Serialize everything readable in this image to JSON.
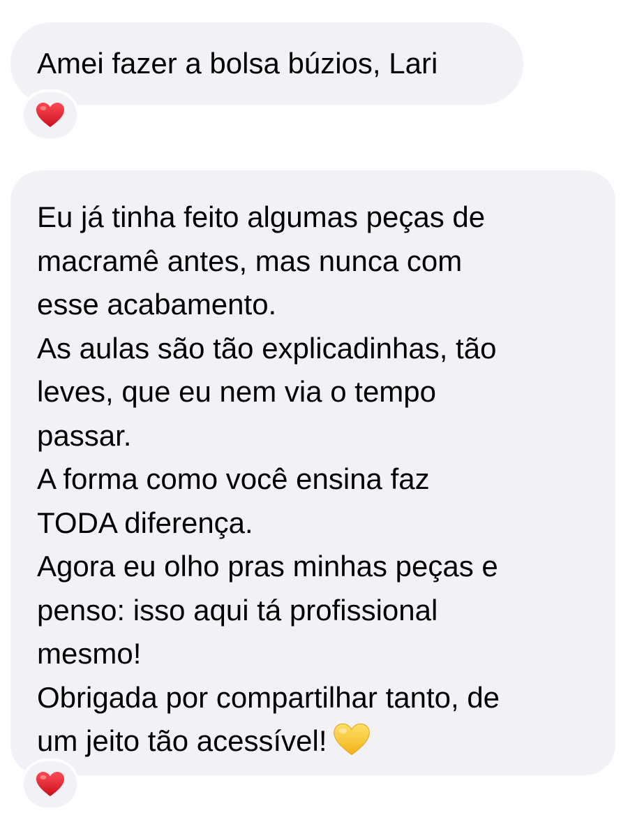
{
  "messages": [
    {
      "text": "Amei fazer a bolsa búzios, Lari",
      "reaction": "red-heart"
    },
    {
      "lines": [
        "Eu já tinha feito algumas peças de",
        "macramê antes, mas nunca com",
        "esse acabamento.",
        "As aulas são tão explicadinhas, tão",
        "leves, que eu nem via o tempo",
        "passar.",
        "A forma como você ensina faz",
        "TODA diferença.",
        "Agora eu olho pras minhas peças e",
        "penso: isso aqui tá profissional",
        "mesmo!",
        "Obrigada por compartilhar tanto, de",
        "um jeito tão acessível!"
      ],
      "trailing_emoji": "yellow-heart",
      "reaction": "red-heart"
    }
  ],
  "colors": {
    "bubble": "#f2f2f6",
    "text": "#000000",
    "heart_red": "#e0131f",
    "heart_yellow": "#f7c531"
  }
}
